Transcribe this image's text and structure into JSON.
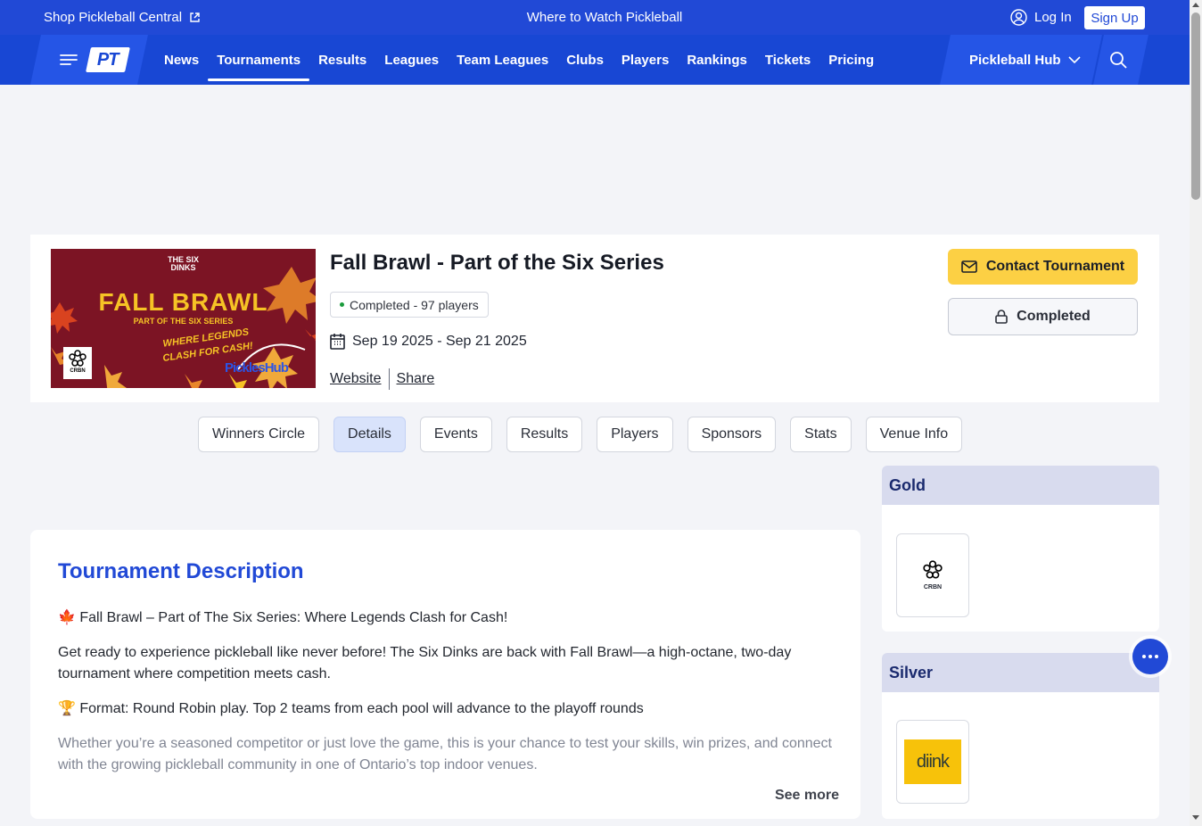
{
  "topbar": {
    "shop_label": "Shop Pickleball Central",
    "watch_label": "Where to Watch Pickleball",
    "login_label": "Log In",
    "signup_label": "Sign Up"
  },
  "nav": {
    "logo_text": "PT",
    "items": [
      {
        "label": "News",
        "active": false
      },
      {
        "label": "Tournaments",
        "active": true
      },
      {
        "label": "Results",
        "active": false
      },
      {
        "label": "Leagues",
        "active": false
      },
      {
        "label": "Team Leagues",
        "active": false
      },
      {
        "label": "Clubs",
        "active": false
      },
      {
        "label": "Players",
        "active": false
      },
      {
        "label": "Rankings",
        "active": false
      },
      {
        "label": "Tickets",
        "active": false
      },
      {
        "label": "Pricing",
        "active": false
      }
    ],
    "hub_label": "Pickleball Hub"
  },
  "tournament": {
    "title": "Fall Brawl - Part of the Six Series",
    "status": "Completed - 97 players",
    "dates": "Sep 19 2025 - Sep 21 2025",
    "website_label": "Website",
    "share_label": "Share",
    "contact_label": "Contact Tournament",
    "completed_label": "Completed",
    "banner": {
      "top_line1": "THE SIX",
      "top_line2": "DINKS",
      "title": "FALL BRAWL",
      "subtitle": "PART OF THE SIX SERIES",
      "tagline": "WHERE LEGENDS CLASH FOR CASH!",
      "crbn": "CRBN",
      "hub": "PicklesHub"
    }
  },
  "tabs": [
    {
      "label": "Winners Circle",
      "active": false
    },
    {
      "label": "Details",
      "active": true
    },
    {
      "label": "Events",
      "active": false
    },
    {
      "label": "Results",
      "active": false
    },
    {
      "label": "Players",
      "active": false
    },
    {
      "label": "Sponsors",
      "active": false
    },
    {
      "label": "Stats",
      "active": false
    },
    {
      "label": "Venue Info",
      "active": false
    }
  ],
  "description": {
    "heading": "Tournament Description",
    "paragraphs": [
      "🍁 Fall Brawl – Part of The Six Series: Where Legends Clash for Cash!",
      "Get ready to experience pickleball like never before! The Six Dinks are back with Fall Brawl—a high-octane, two-day tournament where competition meets cash.",
      "🏆 Format: Round Robin play. Top 2 teams from each pool will advance to the playoff rounds",
      "Whether you’re a seasoned competitor or just love the game, this is your chance to test your skills, win prizes, and connect with the growing pickleball community in one of Ontario’s top indoor venues."
    ],
    "see_more_label": "See more"
  },
  "sponsors": {
    "gold_label": "Gold",
    "gold_logo_text": "CRBN",
    "silver_label": "Silver",
    "silver_logo_text": "diink"
  },
  "colors": {
    "brand_blue": "#2149d6",
    "accent_yellow": "#fcd044",
    "status_green": "#1a9b3c"
  }
}
